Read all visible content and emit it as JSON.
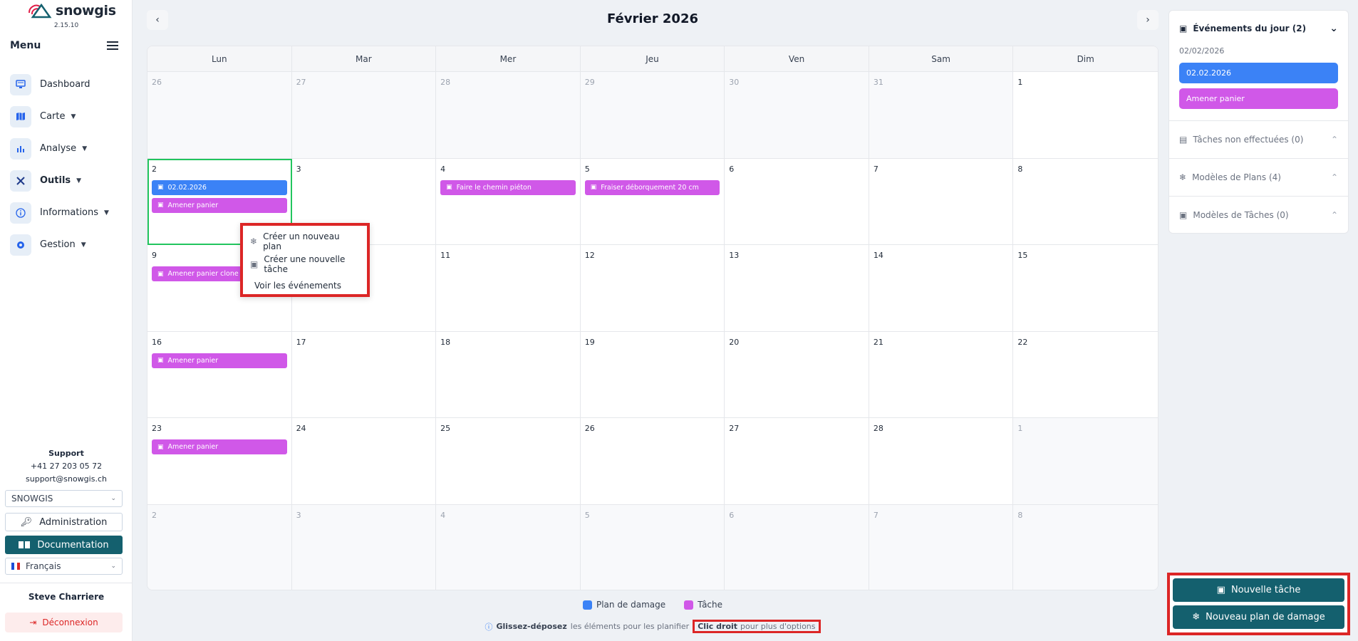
{
  "app": {
    "name": "snowgis",
    "version": "2.15.10"
  },
  "menu": {
    "title": "Menu"
  },
  "nav": [
    {
      "label": "Dashboard",
      "icon": "dashboard-icon",
      "dropdown": false
    },
    {
      "label": "Carte",
      "icon": "map-icon",
      "dropdown": true
    },
    {
      "label": "Analyse",
      "icon": "chart-icon",
      "dropdown": true
    },
    {
      "label": "Outils",
      "icon": "tools-icon",
      "dropdown": true,
      "active": true
    },
    {
      "label": "Informations",
      "icon": "info-icon",
      "dropdown": true
    },
    {
      "label": "Gestion",
      "icon": "gear-icon",
      "dropdown": true
    }
  ],
  "support": {
    "title": "Support",
    "phone": "+41 27 203 05 72",
    "email": "support@snowgis.ch"
  },
  "org_select": "SNOWGIS",
  "admin_label": "Administration",
  "doc_label": "Documentation",
  "language": "Français",
  "user_name": "Steve Charriere",
  "logout_label": "Déconnexion",
  "calendar": {
    "month_title": "Février 2026",
    "weekdays": [
      "Lun",
      "Mar",
      "Mer",
      "Jeu",
      "Ven",
      "Sam",
      "Dim"
    ],
    "weeks": [
      [
        {
          "d": "26",
          "o": true
        },
        {
          "d": "27",
          "o": true
        },
        {
          "d": "28",
          "o": true
        },
        {
          "d": "29",
          "o": true
        },
        {
          "d": "30",
          "o": true
        },
        {
          "d": "31",
          "o": true
        },
        {
          "d": "1"
        }
      ],
      [
        {
          "d": "2",
          "sel": true,
          "ev": [
            {
              "t": "plan",
              "l": "02.02.2026"
            },
            {
              "t": "task",
              "l": "Amener panier"
            }
          ]
        },
        {
          "d": "3"
        },
        {
          "d": "4",
          "ev": [
            {
              "t": "task",
              "l": "Faire le chemin piéton"
            }
          ]
        },
        {
          "d": "5",
          "ev": [
            {
              "t": "task",
              "l": "Fraiser déborquement 20 cm"
            }
          ]
        },
        {
          "d": "6"
        },
        {
          "d": "7"
        },
        {
          "d": "8"
        }
      ],
      [
        {
          "d": "9",
          "ev": [
            {
              "t": "task",
              "l": "Amener panier clone"
            }
          ]
        },
        {
          "d": "10"
        },
        {
          "d": "11"
        },
        {
          "d": "12"
        },
        {
          "d": "13"
        },
        {
          "d": "14"
        },
        {
          "d": "15"
        }
      ],
      [
        {
          "d": "16",
          "ev": [
            {
              "t": "task",
              "l": "Amener panier"
            }
          ]
        },
        {
          "d": "17"
        },
        {
          "d": "18"
        },
        {
          "d": "19"
        },
        {
          "d": "20"
        },
        {
          "d": "21"
        },
        {
          "d": "22"
        }
      ],
      [
        {
          "d": "23",
          "ev": [
            {
              "t": "task",
              "l": "Amener panier"
            }
          ]
        },
        {
          "d": "24"
        },
        {
          "d": "25"
        },
        {
          "d": "26"
        },
        {
          "d": "27"
        },
        {
          "d": "28"
        },
        {
          "d": "1",
          "o": true
        }
      ],
      [
        {
          "d": "2",
          "o": true
        },
        {
          "d": "3",
          "o": true
        },
        {
          "d": "4",
          "o": true
        },
        {
          "d": "5",
          "o": true
        },
        {
          "d": "6",
          "o": true
        },
        {
          "d": "7",
          "o": true
        },
        {
          "d": "8",
          "o": true
        }
      ]
    ]
  },
  "context_menu": {
    "new_plan": "Créer un nouveau plan",
    "new_task": "Créer une nouvelle tâche",
    "view_events": "Voir les événements"
  },
  "legend": {
    "plan": "Plan de damage",
    "task": "Tâche",
    "plan_color": "#3b82f6",
    "task_color": "#d058e8"
  },
  "hint": {
    "drag_bold": "Glissez-déposez",
    "drag_rest": "les éléments pour les planifier",
    "right_bold": "Clic droit",
    "right_rest": "pour plus d'options"
  },
  "panel": {
    "title": "Événements du jour (2)",
    "date": "02/02/2026",
    "events": [
      {
        "label": "02.02.2026",
        "type": "plan"
      },
      {
        "label": "Amener panier",
        "type": "task"
      }
    ],
    "sections": [
      "Tâches non effectuées (0)",
      "Modèles de Plans (4)",
      "Modèles de Tâches (0)"
    ]
  },
  "actions": {
    "new_task": "Nouvelle tâche",
    "new_plan": "Nouveau plan de damage"
  }
}
